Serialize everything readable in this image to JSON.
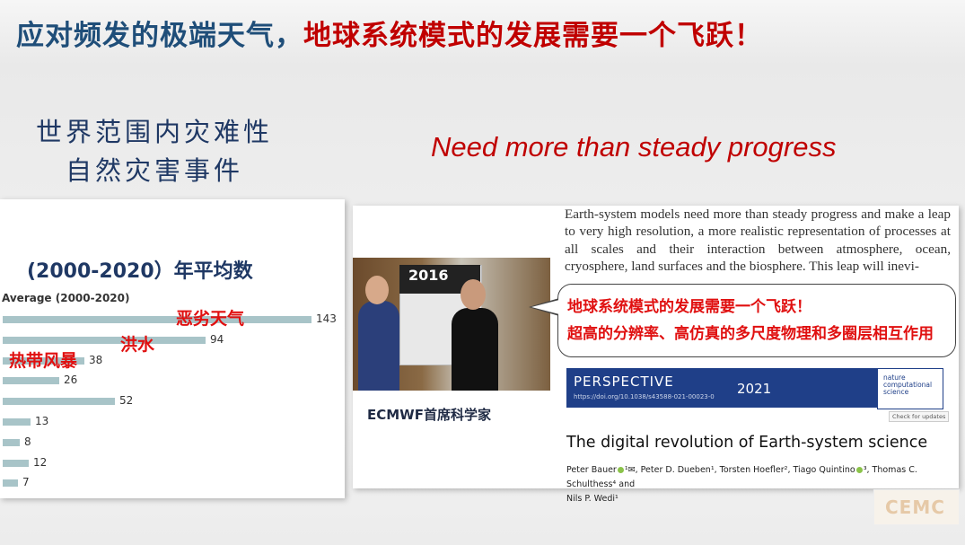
{
  "header": {
    "title_part1": "应对频发的极端天气，",
    "title_part2": "地球系统模式的发展需要一个飞跃！"
  },
  "left_heading": {
    "line1": "世界范围内灾难性",
    "line2": "自然灾害事件"
  },
  "subtitle": "Need more than steady progress",
  "chart_data": {
    "type": "bar",
    "title": "(2000-2020）年平均数",
    "series_label": "Average (2000-2020)",
    "orientation": "horizontal",
    "values": [
      143,
      94,
      38,
      26,
      52,
      13,
      8,
      12,
      7
    ],
    "category_labels": [
      "恶劣天气",
      "洪水",
      "热带风暴"
    ],
    "bar_color": "#a8c4c8",
    "label_color": "#e01010"
  },
  "photo": {
    "caption": "ECMWF首席科学家",
    "banner_text": "2016"
  },
  "abstract": "Earth-system models need more than steady progress and make a leap to very high resolution, a more realistic representation of processes at all scales and their interaction between atmosphere, ocean, cryosphere, land surfaces and the biosphere. This leap will inevi-",
  "callout": {
    "line1": "地球系统模式的发展需要一个飞跃！",
    "line2": "超高的分辨率、高仿真的多尺度物理和多圈层相互作用"
  },
  "perspective": {
    "label": "PERSPECTIVE",
    "doi": "https://doi.org/10.1038/s43588-021-00023-0",
    "year": "2021",
    "journal": "nature computational science",
    "check_updates": "Check for updates"
  },
  "paper": {
    "title": "The digital revolution of Earth-system science",
    "authors_line1": "Peter Bauer",
    "authors_line1_rest": "¹✉, Peter D. Dueben¹, Torsten Hoefler², Tiago Quintino",
    "authors_line1_tail": "³, Thomas C. Schulthess⁴ and",
    "authors_line2": "Nils P. Wedi¹"
  },
  "logo": "CEMC"
}
